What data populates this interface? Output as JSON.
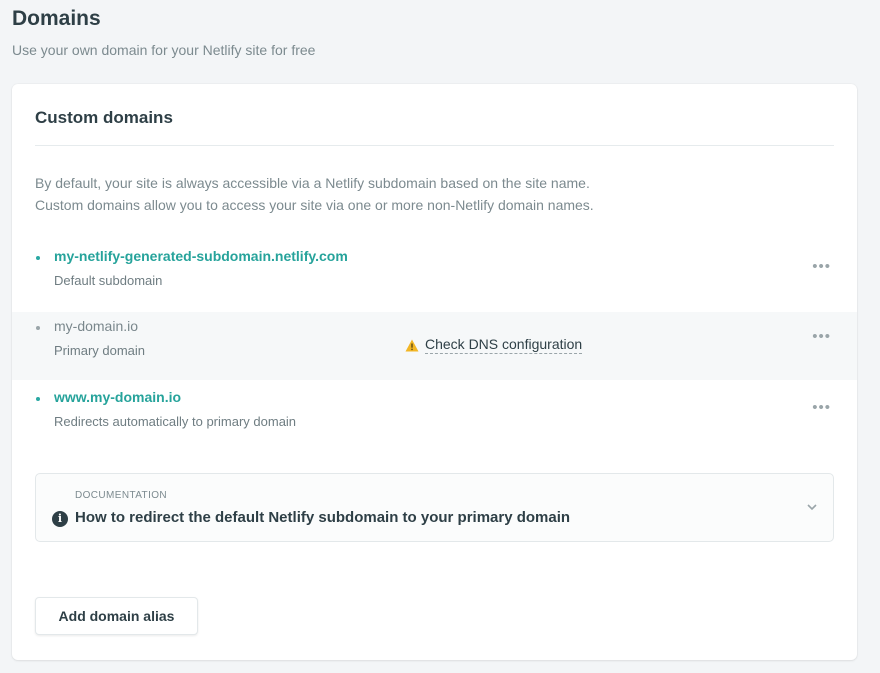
{
  "page": {
    "title": "Domains",
    "subtitle": "Use your own domain for your Netlify site for free"
  },
  "card": {
    "title": "Custom domains",
    "description_line1": "By default, your site is always accessible via a Netlify subdomain based on the site name.",
    "description_line2": "Custom domains allow you to access your site via one or more non-Netlify domain names."
  },
  "domains": [
    {
      "name": "my-netlify-generated-subdomain.netlify.com",
      "subtitle": "Default subdomain",
      "more": "•••"
    },
    {
      "name": "my-domain.io",
      "subtitle": "Primary domain",
      "warning": "Check DNS configuration",
      "more": "•••"
    },
    {
      "name": "www.my-domain.io",
      "subtitle": "Redirects automatically to primary domain",
      "more": "•••"
    }
  ],
  "documentation": {
    "label": "DOCUMENTATION",
    "title": "How to redirect the default Netlify subdomain to your primary domain",
    "icon": "info-icon"
  },
  "actions": {
    "add_alias_label": "Add domain alias"
  },
  "colors": {
    "accent": "#26a39b",
    "warning": "#f2b625",
    "text": "#2e3f46",
    "muted": "#7c8a8f"
  }
}
